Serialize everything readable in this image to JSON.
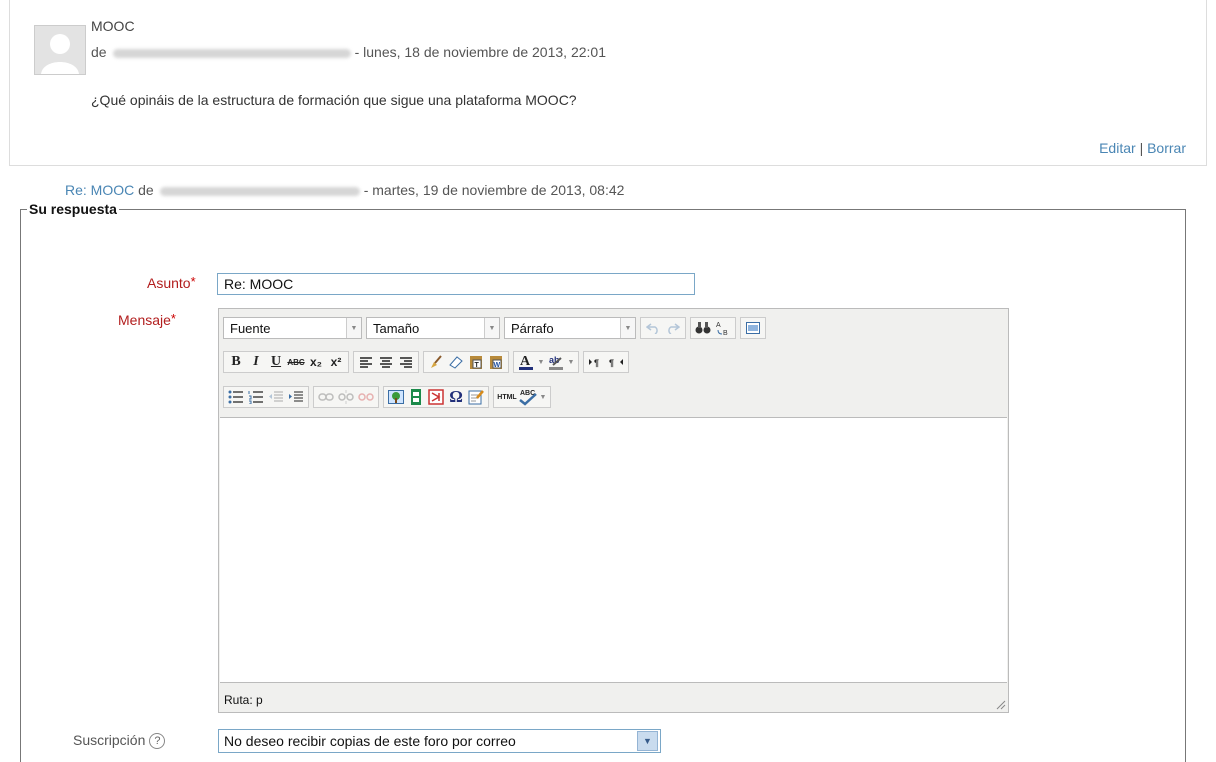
{
  "post": {
    "subject": "MOOC",
    "by_prefix": "de",
    "date": "- lunes, 18 de noviembre de 2013, 22:01",
    "body": "¿Qué opináis de la estructura de formación que sigue una plataforma MOOC?",
    "edit_label": "Editar",
    "separator": "|",
    "delete_label": "Borrar"
  },
  "reply_link": {
    "subject": "Re: MOOC",
    "by_prefix": "de",
    "date": "- martes, 19 de noviembre de 2013, 08:42"
  },
  "form": {
    "legend": "Su respuesta",
    "subject_label": "Asunto",
    "subject_value": "Re: MOOC",
    "message_label": "Mensaje",
    "required_mark": "*",
    "subscription_label": "Suscripción",
    "subscription_value": "No deseo recibir copias de este foro por correo",
    "help_glyph": "?"
  },
  "editor": {
    "font_select": "Fuente",
    "size_select": "Tamaño",
    "format_select": "Párrafo",
    "path_text": "Ruta: p",
    "toolbar_row2": [
      {
        "name": "bold-button",
        "glyph": "B"
      },
      {
        "name": "italic-button",
        "glyph": "I"
      },
      {
        "name": "underline-button",
        "glyph": "U"
      },
      {
        "name": "strikethrough-button",
        "glyph": "ABC"
      },
      {
        "name": "subscript-button",
        "glyph": "x₂"
      },
      {
        "name": "superscript-button",
        "glyph": "x²"
      }
    ]
  },
  "colors": {
    "link": "#4a86b4",
    "label_required": "#b21d1d",
    "toolbar_bg": "#f0f0ee"
  }
}
